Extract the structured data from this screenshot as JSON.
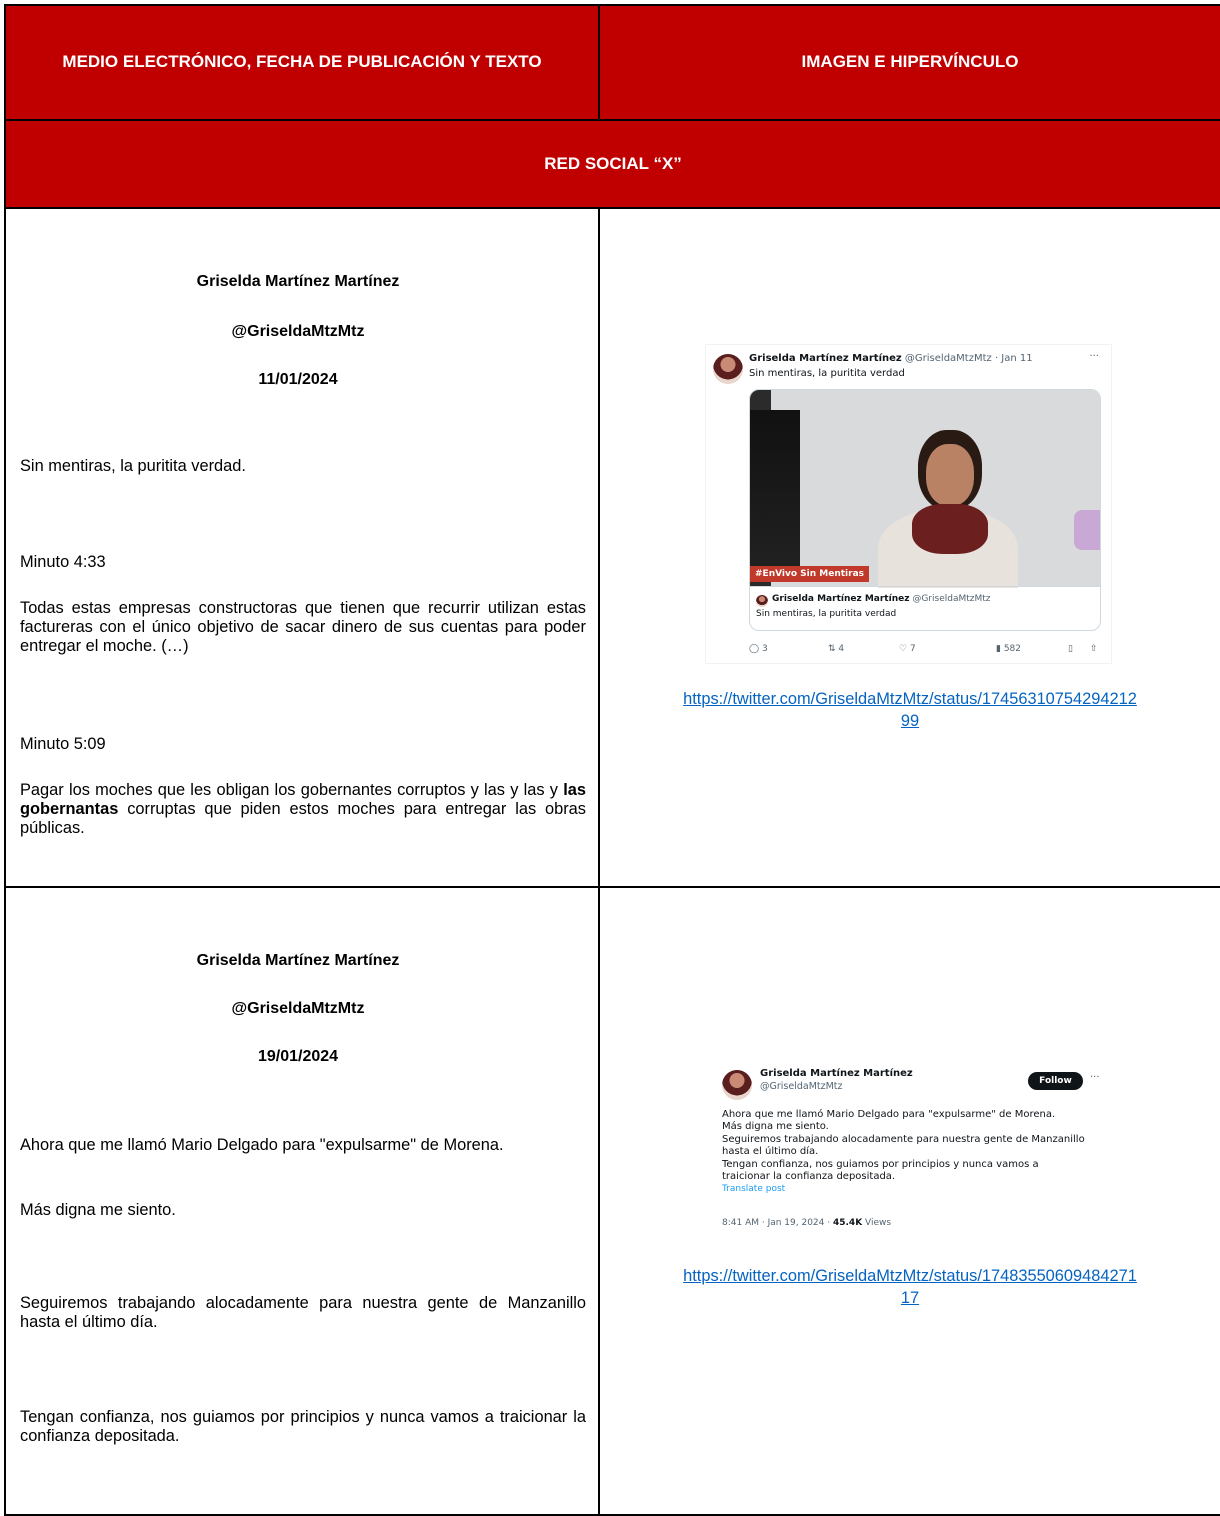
{
  "header": {
    "col1": "MEDIO ELECTRÓNICO, FECHA DE PUBLICACIÓN Y TEXTO",
    "col2": "IMAGEN E HIPERVÍNCULO",
    "section": "RED SOCIAL “X”"
  },
  "rows": [
    {
      "name": "Griselda Martínez Martínez",
      "handle": "@GriseldaMtzMtz",
      "date": "11/01/2024",
      "p1": "Sin mentiras, la puritita verdad.",
      "p2": "Minuto 4:33",
      "p3": "Todas estas empresas constructoras que tienen que recurrir utilizan estas factureras con el único objetivo de sacar dinero de sus cuentas para poder entregar el moche. (…)",
      "p4": "Minuto 5:09",
      "p5a": "Pagar los moches que les obligan los gobernantes corruptos y las y las y ",
      "p5b": "las gobernantas",
      "p5c": " corruptas que piden estos moches para entregar las obras públicas.",
      "link_l1": "https://twitter.com/GriseldaMtzMtz/status/17456310754294212",
      "link_l2": "99",
      "tweet": {
        "author": "Griselda Martínez Martínez",
        "meta": "@GriseldaMtzMtz · Jan 11",
        "more": "···",
        "text": "Sin mentiras, la puritita verdad",
        "video_tag": "#EnVivo Sin Mentiras",
        "quote_author": "Griselda Martínez Martínez",
        "quote_handle": "@GriseldaMtzMtz",
        "quote_text": "Sin mentiras, la puritita verdad",
        "replies": "3",
        "reposts": "4",
        "likes": "7",
        "views": "582"
      }
    },
    {
      "name": "Griselda Martínez Martínez",
      "handle": "@GriseldaMtzMtz",
      "date": "19/01/2024",
      "p1": "Ahora que me llamó Mario Delgado para \"expulsarme\" de Morena.",
      "p2": "Más digna me siento.",
      "p3": "Seguiremos trabajando alocadamente para nuestra gente de Manzanillo hasta el último día.",
      "p4": "Tengan confianza, nos guiamos por principios y nunca vamos a traicionar la confianza depositada.",
      "link_l1": "https://twitter.com/GriseldaMtzMtz/status/17483550609484271",
      "link_l2": "17",
      "tweet": {
        "author": "Griselda Martínez Martínez",
        "handle": "@GriseldaMtzMtz",
        "follow": "Follow",
        "more": "···",
        "line1": "Ahora que me llamó Mario Delgado para \"expulsarme\" de Morena.",
        "line2": "Más digna me siento.",
        "line3": "Seguiremos trabajando alocadamente para nuestra gente de Manzanillo",
        "line4": "hasta el último día.",
        "line5": "Tengan confianza, nos guiamos por principios y nunca vamos a",
        "line6": "traicionar la confianza depositada.",
        "translate": "Translate post",
        "time": "8:41 AM · Jan 19, 2024 · ",
        "views": "45.4K",
        "views_label": " Views"
      }
    }
  ],
  "colors": {
    "header_red": "#c00000",
    "link_blue": "#0563c1",
    "video_tag_red": "#c0392b"
  },
  "icons": [
    "reply-icon",
    "repost-icon",
    "like-icon",
    "views-icon",
    "bookmark-icon",
    "share-icon"
  ]
}
